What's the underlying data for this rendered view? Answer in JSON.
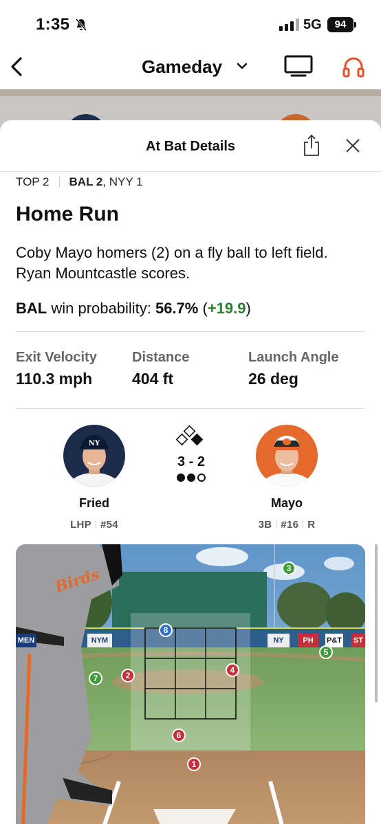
{
  "status": {
    "time": "1:35",
    "network": "5G",
    "battery": "94"
  },
  "header": {
    "title": "Gameday"
  },
  "sheet": {
    "title": "At Bat Details"
  },
  "inning": {
    "half": "TOP 2",
    "score_lead": "BAL 2",
    "score_rest": ", NYY 1"
  },
  "result": {
    "title": "Home Run",
    "description": "Coby Mayo homers (2) on a fly ball to left field. Ryan Mountcastle scores."
  },
  "win_probability": {
    "team": "BAL",
    "label": " win probability: ",
    "value": "56.7%",
    "open": " (",
    "delta": "+19.9",
    "close": ")"
  },
  "stats": [
    {
      "label": "Exit Velocity",
      "value": "110.3 mph"
    },
    {
      "label": "Distance",
      "value": "404 ft"
    },
    {
      "label": "Launch Angle",
      "value": "26 deg"
    }
  ],
  "pitcher": {
    "name": "Fried",
    "hand": "LHP",
    "number": "#54"
  },
  "batter": {
    "name": "Mayo",
    "position": "3B",
    "number": "#16",
    "bats": "R"
  },
  "count": {
    "text": "3 - 2",
    "outs": 2
  },
  "ad_boards": [
    "MEN",
    "NYM",
    "NY",
    "PH",
    "P&T",
    "ST"
  ],
  "pitches": [
    {
      "n": "1",
      "result": "strike"
    },
    {
      "n": "2",
      "result": "strike"
    },
    {
      "n": "3",
      "result": "ball"
    },
    {
      "n": "4",
      "result": "strike"
    },
    {
      "n": "5",
      "result": "ball"
    },
    {
      "n": "6",
      "result": "strike"
    },
    {
      "n": "7",
      "result": "ball"
    },
    {
      "n": "8",
      "result": "inplay"
    }
  ],
  "colors": {
    "accent_orange": "#e8502a",
    "positive_green": "#2e7d32",
    "ball_green": "#3e9c3a",
    "strike_red": "#c62f3a",
    "inplay_blue": "#2f6fd0"
  }
}
